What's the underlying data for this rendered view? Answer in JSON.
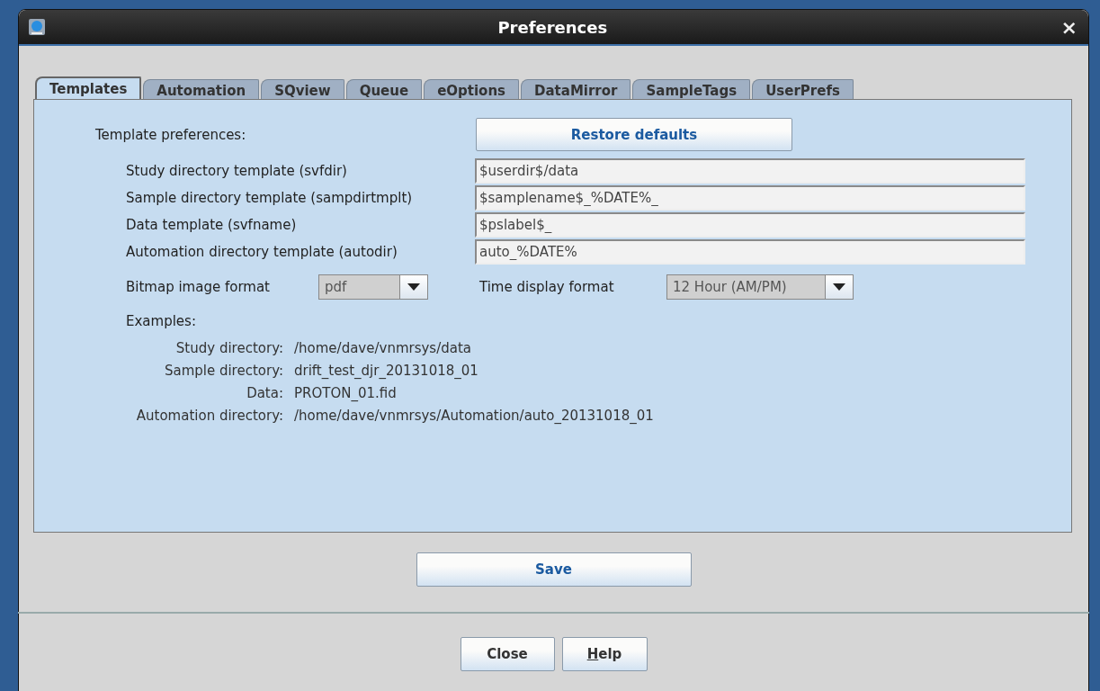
{
  "window": {
    "title": "Preferences",
    "close": "×"
  },
  "tabs": [
    {
      "label": "Templates",
      "selected": true
    },
    {
      "label": "Automation",
      "selected": false
    },
    {
      "label": "SQview",
      "selected": false
    },
    {
      "label": "Queue",
      "selected": false
    },
    {
      "label": "eOptions",
      "selected": false
    },
    {
      "label": "DataMirror",
      "selected": false
    },
    {
      "label": "SampleTags",
      "selected": false
    },
    {
      "label": "UserPrefs",
      "selected": false
    }
  ],
  "section_label": "Template preferences:",
  "restore_button": "Restore defaults",
  "fields": [
    {
      "label": "Study directory template (svfdir)",
      "value": "$userdir$/data"
    },
    {
      "label": "Sample directory template (sampdirtmplt)",
      "value": "$samplename$_%DATE%_"
    },
    {
      "label": "Data template (svfname)",
      "value": "$pslabel$_"
    },
    {
      "label": "Automation directory template (autodir)",
      "value": "auto_%DATE%"
    }
  ],
  "dropdowns": [
    {
      "label": "Bitmap image format",
      "value": "pdf"
    },
    {
      "label": "Time display format",
      "value": "12 Hour (AM/PM)"
    }
  ],
  "examples_label": "Examples:",
  "examples": [
    {
      "label": "Study directory:",
      "value": "/home/dave/vnmrsys/data"
    },
    {
      "label": "Sample directory:",
      "value": "drift_test_djr_20131018_01"
    },
    {
      "label": "Data:",
      "value": "PROTON_01.fid"
    },
    {
      "label": "Automation directory:",
      "value": "/home/dave/vnmrsys/Automation/auto_20131018_01"
    }
  ],
  "save_button": "Save",
  "bottom_buttons": [
    {
      "label": "Close",
      "mnemonic_underlined": false
    },
    {
      "label": "Help",
      "mnemonic_underlined": true
    }
  ]
}
